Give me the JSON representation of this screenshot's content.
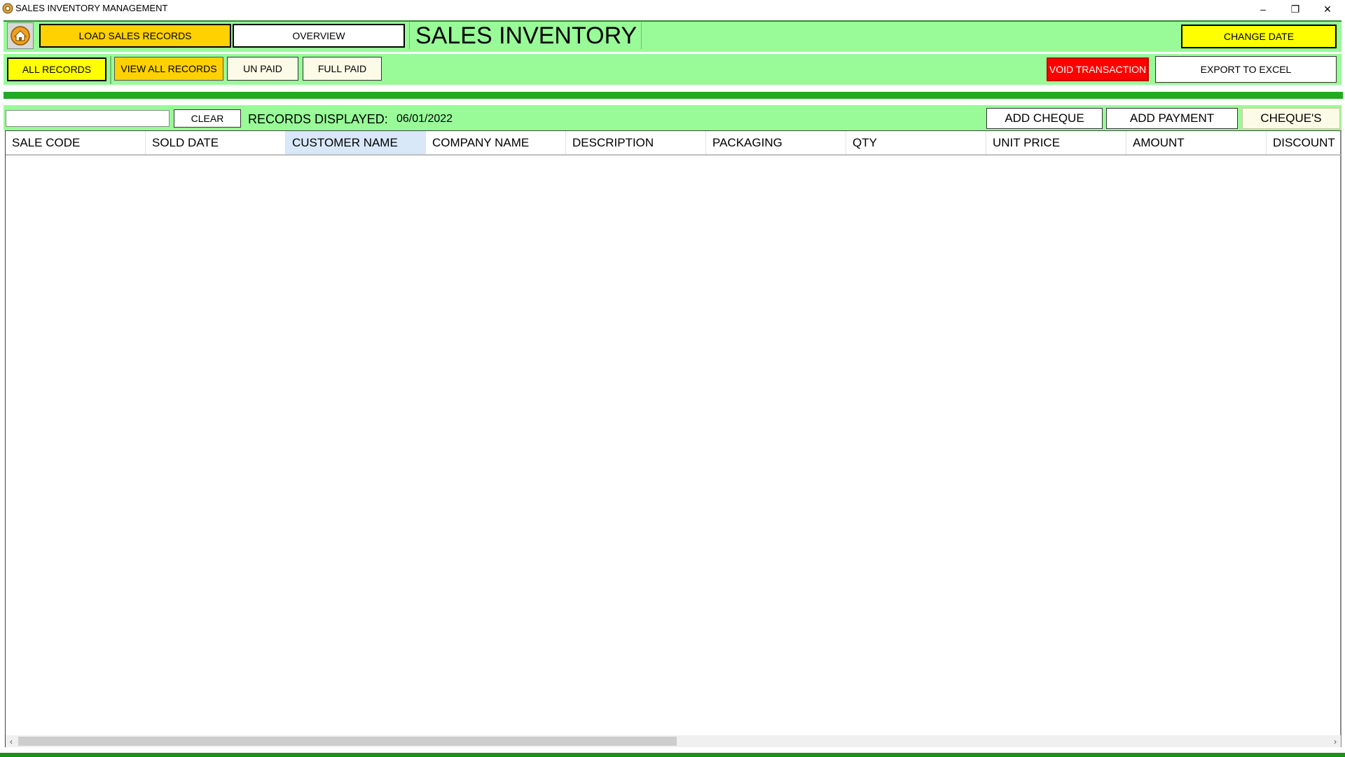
{
  "window": {
    "title": "SALES INVENTORY MANAGEMENT",
    "controls": [
      "–",
      "❐",
      "✕"
    ]
  },
  "toolbar": {
    "load_sales_records": "LOAD SALES RECORDS",
    "overview": "OVERVIEW",
    "app_heading": "SALES INVENTORY",
    "change_date": "CHANGE DATE"
  },
  "filters": {
    "all_records": "ALL RECORDS",
    "view_all_records": "VIEW ALL RECORDS",
    "un_paid": "UN PAID",
    "full_paid": "FULL PAID",
    "void_transaction": "VOID TRANSACTION",
    "export_to_excel": "EXPORT TO EXCEL"
  },
  "search": {
    "value": "",
    "clear_label": "CLEAR",
    "records_label": "RECORDS DISPLAYED:",
    "records_date": "06/01/2022",
    "add_cheque": "ADD CHEQUE",
    "add_payment": "ADD PAYMENT",
    "cheques": "CHEQUE'S"
  },
  "grid": {
    "columns": [
      "SALE CODE",
      "SOLD DATE",
      "CUSTOMER NAME",
      "COMPANY NAME",
      "DESCRIPTION",
      "PACKAGING",
      "QTY",
      "UNIT PRICE",
      "AMOUNT",
      "DISCOUNT"
    ],
    "rows": []
  },
  "colors": {
    "band": "#98fb98",
    "accent_yellow": "#ffff00",
    "accent_gold": "#ffd100",
    "danger": "#ff0000",
    "divider_green": "#22aa22",
    "selected_header": "#d8e8f8"
  },
  "icons": {
    "home": "home-icon"
  }
}
